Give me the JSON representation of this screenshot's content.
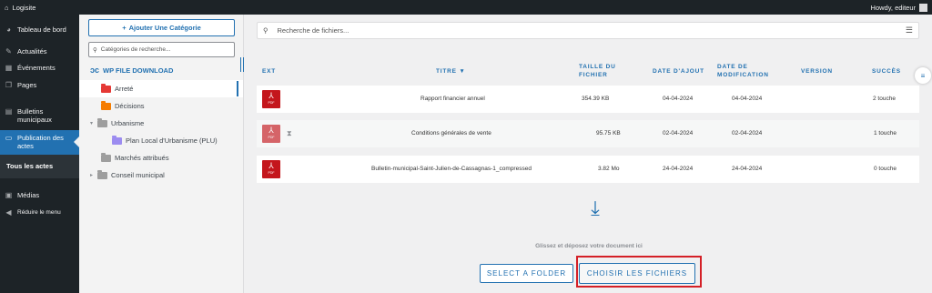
{
  "adminbar": {
    "site_name": "Logisite",
    "user_greeting": "Howdy, editeur"
  },
  "wpmenu": {
    "items": [
      {
        "label": "Tableau de bord",
        "icon": "dashboard-icon"
      },
      {
        "label": "Actualités",
        "icon": "pin-icon"
      },
      {
        "label": "Événements",
        "icon": "calendar-icon"
      },
      {
        "label": "Pages",
        "icon": "pages-icon"
      },
      {
        "label": "Bulletins municipaux",
        "icon": "document-icon"
      },
      {
        "label": "Publication des actes",
        "icon": "folder-icon"
      },
      {
        "label": "Médias",
        "icon": "media-icon"
      },
      {
        "label": "Réduire le menu",
        "icon": "collapse-icon"
      }
    ],
    "submenu": {
      "label": "Tous les actes"
    }
  },
  "categories": {
    "add_label": "Ajouter Une Catégorie",
    "search_placeholder": "Catégories de recherche...",
    "brand": "WP FILE DOWNLOAD",
    "tree": [
      {
        "label": "Arreté",
        "color": "#e53935",
        "depth": 0,
        "caret": "",
        "selected": true
      },
      {
        "label": "Décisions",
        "color": "#f57c00",
        "depth": 0,
        "caret": ""
      },
      {
        "label": "Urbanisme",
        "color": "#9e9e9e",
        "depth": 0,
        "caret": "▾"
      },
      {
        "label": "Plan Local d'Urbanisme (PLU)",
        "color": "#9c8cf0",
        "depth": 1,
        "caret": ""
      },
      {
        "label": "Marchés attribués",
        "color": "#9e9e9e",
        "depth": 0,
        "caret": ""
      },
      {
        "label": "Conseil municipal",
        "color": "#9e9e9e",
        "depth": 0,
        "caret": "▸"
      }
    ]
  },
  "main": {
    "search_placeholder": "Recherche de fichiers...",
    "columns": {
      "ext": "EXT",
      "title": "TITRE ▼",
      "size_line1": "TAILLE DU",
      "size_line2": "FICHIER",
      "date_added": "DATE D'AJOUT",
      "date_mod_line1": "DATE DE",
      "date_mod_line2": "MODIFICATION",
      "version": "VERSION",
      "hits": "SUCCÈS"
    },
    "files": [
      {
        "ext": "PDF",
        "title": "Rapport financier annuel",
        "size": "354.39 KB",
        "date_added": "04-04-2024",
        "date_modified": "04-04-2024",
        "version": "",
        "hits": "2 touche",
        "pending": false
      },
      {
        "ext": "PDF",
        "title": "Conditions générales de vente",
        "size": "95.75 KB",
        "date_added": "02-04-2024",
        "date_modified": "02-04-2024",
        "version": "",
        "hits": "1 touche",
        "pending": true
      },
      {
        "ext": "PDF",
        "title": "Bulletin-municipal-Saint-Julien-de-Cassagnas-1_compressed",
        "size": "3.82 Mo",
        "date_added": "24-04-2024",
        "date_modified": "24-04-2024",
        "version": "",
        "hits": "0 touche",
        "pending": false
      }
    ],
    "dropzone_text": "Glissez et déposez votre document ici",
    "select_folder_label": "SELECT A FOLDER",
    "choose_files_label": "CHOISIR LES FICHIERS"
  },
  "colors": {
    "accent": "#2271b1",
    "sidebar": "#1d2327",
    "highlight": "#d42027",
    "pdf": "#c4161c"
  }
}
